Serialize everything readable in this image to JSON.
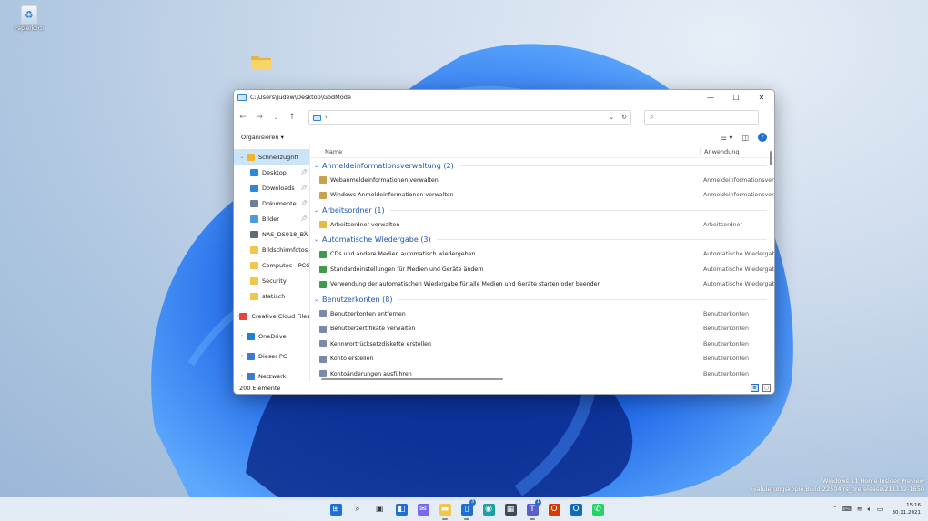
{
  "desktop": {
    "recycle_bin_label": "Papierkorb",
    "watermark_line1": "Windows 11 Home Insider Preview",
    "watermark_line2": "Evaluierungskopie Build 22504.rs_prerelease.211112-1650"
  },
  "window": {
    "title": "C:\\Users\\Judew\\Desktop\\GodMode",
    "address_value": "",
    "search_placeholder": "",
    "organize_label": "Organisieren",
    "status_count": "200 Elemente"
  },
  "columns": {
    "name": "Name",
    "app": "Anwendung"
  },
  "nav": [
    {
      "label": "Schnellzugriff",
      "icon": "star-icon",
      "color": "#f0b429",
      "level": 0,
      "expanded": true,
      "active": true,
      "pinned": false
    },
    {
      "label": "Desktop",
      "icon": "desktop-icon",
      "color": "#2b88d8",
      "level": 1,
      "pinned": true
    },
    {
      "label": "Downloads",
      "icon": "download-icon",
      "color": "#2b88d8",
      "level": 1,
      "pinned": true
    },
    {
      "label": "Dokumente",
      "icon": "document-icon",
      "color": "#6b7f99",
      "level": 1,
      "pinned": true
    },
    {
      "label": "Bilder",
      "icon": "picture-icon",
      "color": "#4a9be0",
      "level": 1,
      "pinned": true
    },
    {
      "label": "NAS_DS918_BA",
      "icon": "network-drive-icon",
      "color": "#5c6b7d",
      "level": 1,
      "pinned": true
    },
    {
      "label": "Bildschirmfotos",
      "icon": "folder-icon",
      "color": "#f3c64a",
      "level": 1,
      "pinned": false
    },
    {
      "label": "Computec - PCGH",
      "icon": "folder-icon",
      "color": "#f3c64a",
      "level": 1,
      "pinned": false
    },
    {
      "label": "Security",
      "icon": "folder-icon",
      "color": "#f3c64a",
      "level": 1,
      "pinned": false
    },
    {
      "label": "statisch",
      "icon": "folder-icon",
      "color": "#f3c64a",
      "level": 1,
      "pinned": false
    },
    {
      "label": "Creative Cloud Files",
      "icon": "creative-cloud-icon",
      "color": "#e8453c",
      "level": 0,
      "expanded": false
    },
    {
      "label": "OneDrive",
      "icon": "onedrive-icon",
      "color": "#1e7fd6",
      "level": 0,
      "expanded": false
    },
    {
      "label": "Dieser PC",
      "icon": "computer-icon",
      "color": "#3a7bd5",
      "level": 0,
      "expanded": false
    },
    {
      "label": "Netzwerk",
      "icon": "network-icon",
      "color": "#3a7bd5",
      "level": 0,
      "expanded": false
    }
  ],
  "groups": [
    {
      "title": "Anmeldeinformationsverwaltung (2)",
      "items": [
        {
          "name": "Webanmeldeinformationen verwalten",
          "app": "Anmeldeinformationsverw",
          "color": "#c9a24a"
        },
        {
          "name": "Windows-Anmeldeinformationen verwalten",
          "app": "Anmeldeinformationsverw",
          "color": "#c9a24a"
        }
      ]
    },
    {
      "title": "Arbeitsordner (1)",
      "items": [
        {
          "name": "Arbeitsordner verwalten",
          "app": "Arbeitsordner",
          "color": "#e8b93c"
        }
      ]
    },
    {
      "title": "Automatische Wiedergabe (3)",
      "items": [
        {
          "name": "CDs und andere Medien automatisch wiedergeben",
          "app": "Automatische Wiedergabe",
          "color": "#3f9a4a"
        },
        {
          "name": "Standardeinstellungen für Medien und Geräte ändern",
          "app": "Automatische Wiedergabe",
          "color": "#3f9a4a"
        },
        {
          "name": "Verwendung der automatischen Wiedergabe für alle Medien und Geräte starten oder beenden",
          "app": "Automatische Wiedergabe",
          "color": "#3f9a4a"
        }
      ]
    },
    {
      "title": "Benutzerkonten (8)",
      "items": [
        {
          "name": "Benutzerkonten entfernen",
          "app": "Benutzerkonten",
          "color": "#7a8aa8"
        },
        {
          "name": "Benutzerzertifikate verwalten",
          "app": "Benutzerkonten",
          "color": "#7a8aa8"
        },
        {
          "name": "Kennwortrücksetzdiskette erstellen",
          "app": "Benutzerkonten",
          "color": "#7a8aa8"
        },
        {
          "name": "Konto erstellen",
          "app": "Benutzerkonten",
          "color": "#7a8aa8"
        },
        {
          "name": "Kontoänderungen ausführen",
          "app": "Benutzerkonten",
          "color": "#7a8aa8"
        }
      ]
    }
  ],
  "taskbar": {
    "apps": [
      {
        "name": "start-icon",
        "glyph": "⊞",
        "color": "#1f6fd1",
        "open": false
      },
      {
        "name": "search-icon",
        "glyph": "⌕",
        "color": "#222222",
        "open": false
      },
      {
        "name": "task-view-icon",
        "glyph": "▣",
        "color": "#333333",
        "open": false
      },
      {
        "name": "widgets-icon",
        "glyph": "◧",
        "color": "#1f6fd1",
        "open": false
      },
      {
        "name": "chat-icon",
        "glyph": "✉",
        "color": "#7b68ee",
        "open": false
      },
      {
        "name": "file-explorer-icon",
        "glyph": "▬",
        "color": "#f3c64a",
        "open": true
      },
      {
        "name": "phone-link-icon",
        "glyph": "▯",
        "color": "#1f6fd1",
        "open": true,
        "badge": "3"
      },
      {
        "name": "edge-icon",
        "glyph": "◉",
        "color": "#1aa3a3",
        "open": false
      },
      {
        "name": "store-icon",
        "glyph": "▦",
        "color": "#3c4a5a",
        "open": false
      },
      {
        "name": "teams-icon",
        "glyph": "T",
        "color": "#5b5fc7",
        "open": true,
        "badge": "1"
      },
      {
        "name": "office-icon",
        "glyph": "O",
        "color": "#d83b01",
        "open": false
      },
      {
        "name": "outlook-icon",
        "glyph": "O",
        "color": "#0f6cbd",
        "open": false
      },
      {
        "name": "whatsapp-icon",
        "glyph": "✆",
        "color": "#25d366",
        "open": false
      }
    ],
    "time": "15:16",
    "date": "30.11.2021"
  }
}
